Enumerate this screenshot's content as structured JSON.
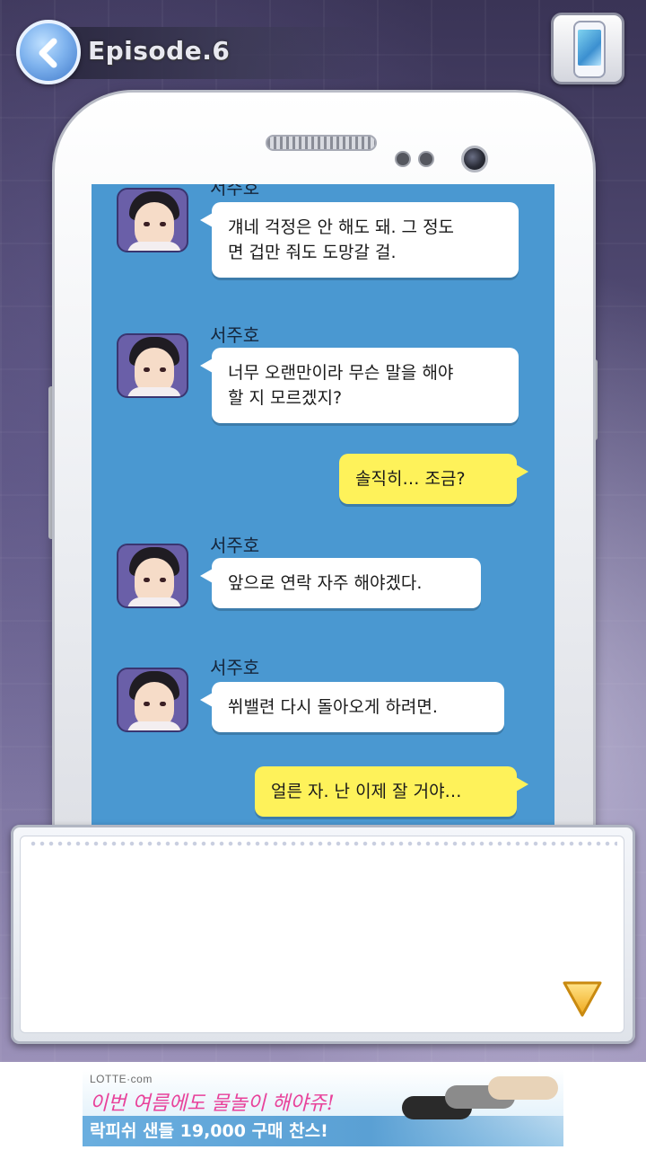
{
  "header": {
    "episode_title": "Episode.6"
  },
  "chat": {
    "messages": [
      {
        "side": "left",
        "sender": "서주호",
        "text_lines": [
          "걔네 걱정은 안 해도 돼. 그 정도",
          "면 겁만 줘도 도망갈 걸."
        ]
      },
      {
        "side": "left",
        "sender": "서주호",
        "text_lines": [
          "너무 오랜만이라 무슨 말을 해야",
          "할 지 모르겠지?"
        ]
      },
      {
        "side": "right",
        "text_lines": [
          "솔직히… 조금?"
        ]
      },
      {
        "side": "left",
        "sender": "서주호",
        "text_lines": [
          "앞으로 연락 자주 해야겠다."
        ]
      },
      {
        "side": "left",
        "sender": "서주호",
        "text_lines": [
          "쒸밸련 다시 돌아오게 하려면."
        ]
      },
      {
        "side": "right",
        "text_lines": [
          "얼른 자. 난 이제 잘 거야…"
        ]
      }
    ]
  },
  "dialog": {
    "text": ""
  },
  "ad": {
    "brand": "LOTTE·com",
    "slogan": "이번 여름에도 물놀이 해야쥬!",
    "headline": "락피쉬 샌들 19,000 구매 찬스!"
  },
  "icons": {
    "back": "back-arrow-icon",
    "phone": "phone-icon",
    "next": "next-triangle-icon"
  },
  "colors": {
    "screen": "#4a98d1",
    "my_bubble": "#fef25a",
    "their_bubble": "#ffffff"
  }
}
